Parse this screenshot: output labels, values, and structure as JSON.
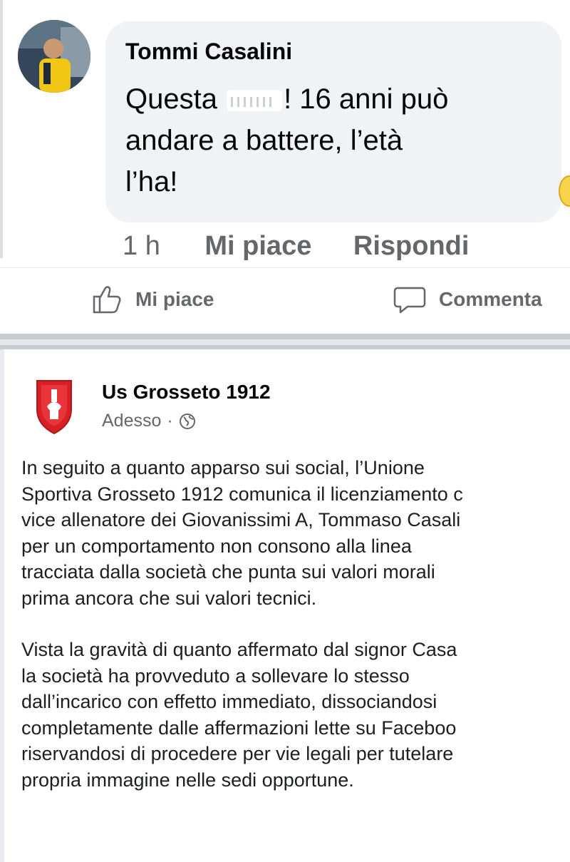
{
  "comment": {
    "author": "Tommi Casalini",
    "text_part1": "Questa ",
    "text_part2": "! 16 anni può",
    "text_line2": "andare a battere, l’età",
    "text_line3": "l’ha!",
    "time": "1 h",
    "like_label": "Mi piace",
    "reply_label": "Rispondi"
  },
  "actions": {
    "like_label": "Mi piace",
    "comment_label": "Commenta"
  },
  "post": {
    "author": "Us Grosseto 1912",
    "timestamp": "Adesso",
    "separator": "·",
    "paragraphs": [
      [
        "In seguito a quanto apparso sui social, l’Unione",
        "Sportiva Grosseto 1912 comunica il licenziamento c",
        "vice allenatore dei Giovanissimi A, Tommaso Casali",
        "per un comportamento non consono alla linea",
        "tracciata dalla società che punta sui valori morali",
        "prima ancora che sui valori tecnici."
      ],
      [
        "Vista la gravità di quanto affermato dal signor Casa",
        "la società ha provveduto a sollevare lo stesso",
        "dall’incarico con effetto immediato, dissociandosi",
        "completamente dalle affermazioni lette su Faceboo",
        "riservandosi di procedere per vie legali per tutelare",
        "propria immagine nelle sedi opportune."
      ]
    ]
  },
  "colors": {
    "bubble": "#f0f2f5",
    "meta_text": "#65676b",
    "crest_red": "#d71f26"
  },
  "icons": [
    "avatar-photo",
    "censor-scribble",
    "emoji-reaction",
    "like-thumb-icon",
    "comment-bubble-icon",
    "club-crest-logo",
    "globe-icon"
  ]
}
